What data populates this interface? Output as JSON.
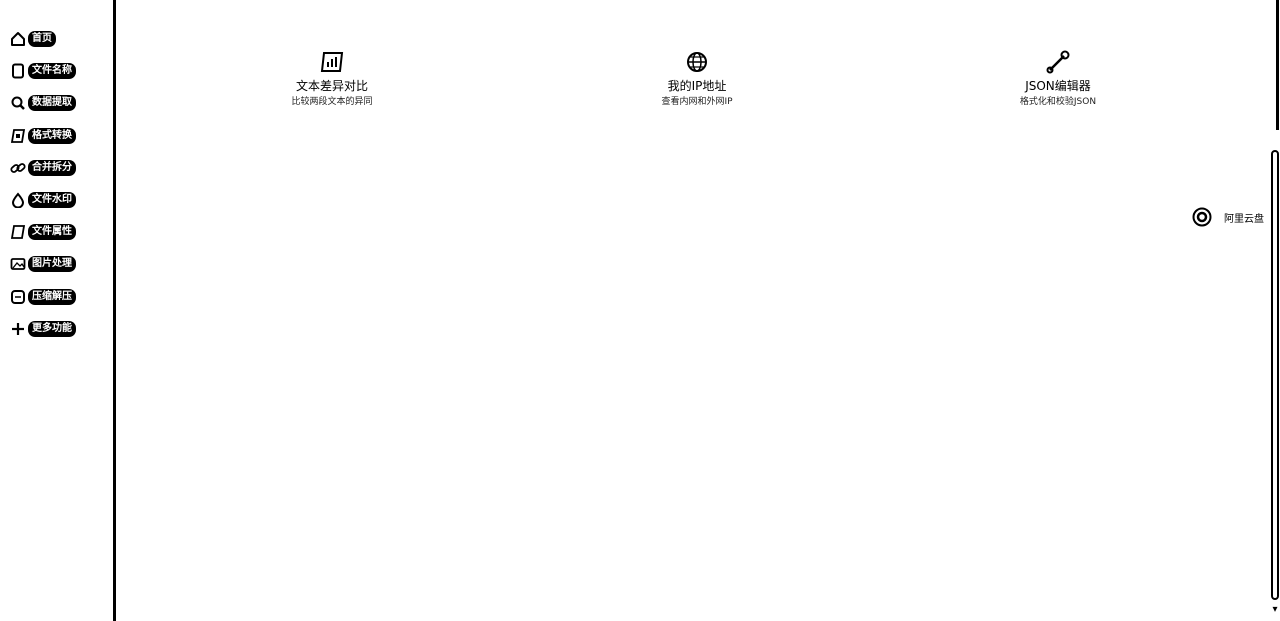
{
  "sidebar": {
    "items": [
      {
        "label": "首页",
        "icon": "home-icon"
      },
      {
        "label": "文件名称",
        "icon": "file-icon"
      },
      {
        "label": "数据提取",
        "icon": "search-icon"
      },
      {
        "label": "格式转换",
        "icon": "convert-icon"
      },
      {
        "label": "合并拆分",
        "icon": "link-icon"
      },
      {
        "label": "文件水印",
        "icon": "drop-icon"
      },
      {
        "label": "文件属性",
        "icon": "document-icon"
      },
      {
        "label": "图片处理",
        "icon": "image-icon"
      },
      {
        "label": "压缩解压",
        "icon": "archive-icon"
      },
      {
        "label": "更多功能",
        "icon": "plus-icon"
      }
    ]
  },
  "tools": [
    {
      "title": "文本差异对比",
      "desc": "比较两段文本的异同",
      "icon": "chart-icon"
    },
    {
      "title": "我的IP地址",
      "desc": "查看内网和外网IP",
      "icon": "globe-icon"
    },
    {
      "title": "JSON编辑器",
      "desc": "格式化和校验JSON",
      "icon": "wrench-icon"
    }
  ],
  "cloud": {
    "label": "阿里云盘",
    "icon": "cloud-drive-icon"
  }
}
